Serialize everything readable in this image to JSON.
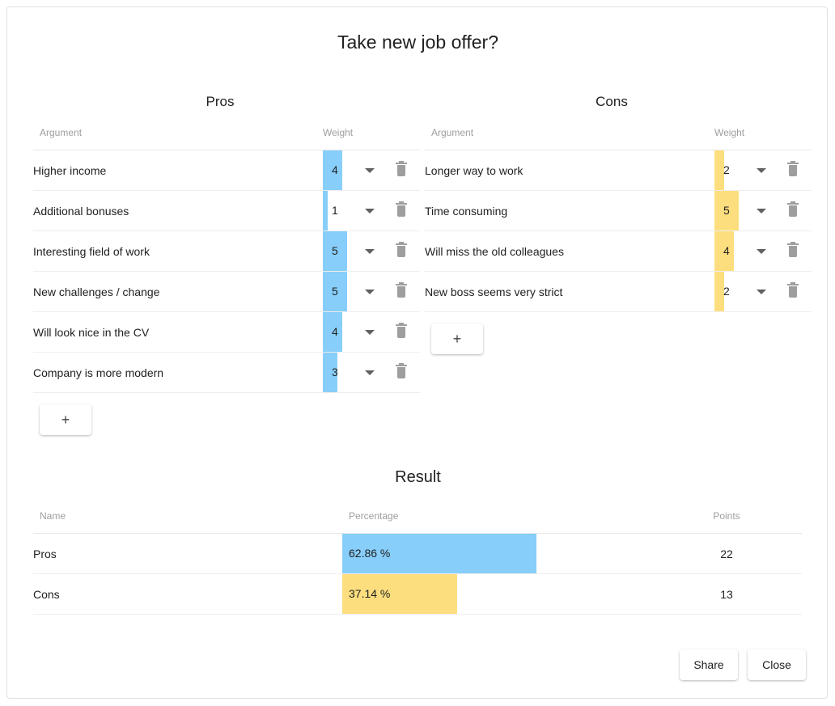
{
  "dialog": {
    "title": "Take new job offer?"
  },
  "colors": {
    "pros": "#87cefa",
    "cons": "#fcde7e",
    "text": "#212121",
    "muted": "#9e9e9e",
    "border": "#eeeeee"
  },
  "panels": {
    "pros": {
      "heading": "Pros",
      "columns": {
        "argument": "Argument",
        "weight": "Weight"
      },
      "add_label": "+",
      "rows": [
        {
          "argument": "Higher income",
          "weight": 4
        },
        {
          "argument": "Additional bonuses",
          "weight": 1
        },
        {
          "argument": "Interesting field of work",
          "weight": 5
        },
        {
          "argument": "New challenges / change",
          "weight": 5
        },
        {
          "argument": "Will look nice in the CV",
          "weight": 4
        },
        {
          "argument": "Company is more modern",
          "weight": 3
        }
      ]
    },
    "cons": {
      "heading": "Cons",
      "columns": {
        "argument": "Argument",
        "weight": "Weight"
      },
      "add_label": "+",
      "rows": [
        {
          "argument": "Longer way to work",
          "weight": 2
        },
        {
          "argument": "Time consuming",
          "weight": 5
        },
        {
          "argument": "Will miss the old colleagues",
          "weight": 4
        },
        {
          "argument": "New boss seems very strict",
          "weight": 2
        }
      ]
    }
  },
  "result": {
    "heading": "Result",
    "columns": {
      "name": "Name",
      "percentage": "Percentage",
      "points": "Points"
    },
    "rows": [
      {
        "name": "Pros",
        "percentage": "62.86 %",
        "percentage_value": 62.86,
        "points": 22
      },
      {
        "name": "Cons",
        "percentage": "37.14 %",
        "percentage_value": 37.14,
        "points": 13
      }
    ]
  },
  "footer": {
    "share_label": "Share",
    "close_label": "Close"
  },
  "chart_data": {
    "type": "bar",
    "title": "Result",
    "categories": [
      "Pros",
      "Cons"
    ],
    "series": [
      {
        "name": "Percentage",
        "values": [
          62.86,
          37.14
        ]
      },
      {
        "name": "Points",
        "values": [
          22,
          13
        ]
      }
    ],
    "xlabel": "",
    "ylabel": "Percentage",
    "ylim": [
      0,
      100
    ],
    "legend": "none",
    "grid": false
  }
}
